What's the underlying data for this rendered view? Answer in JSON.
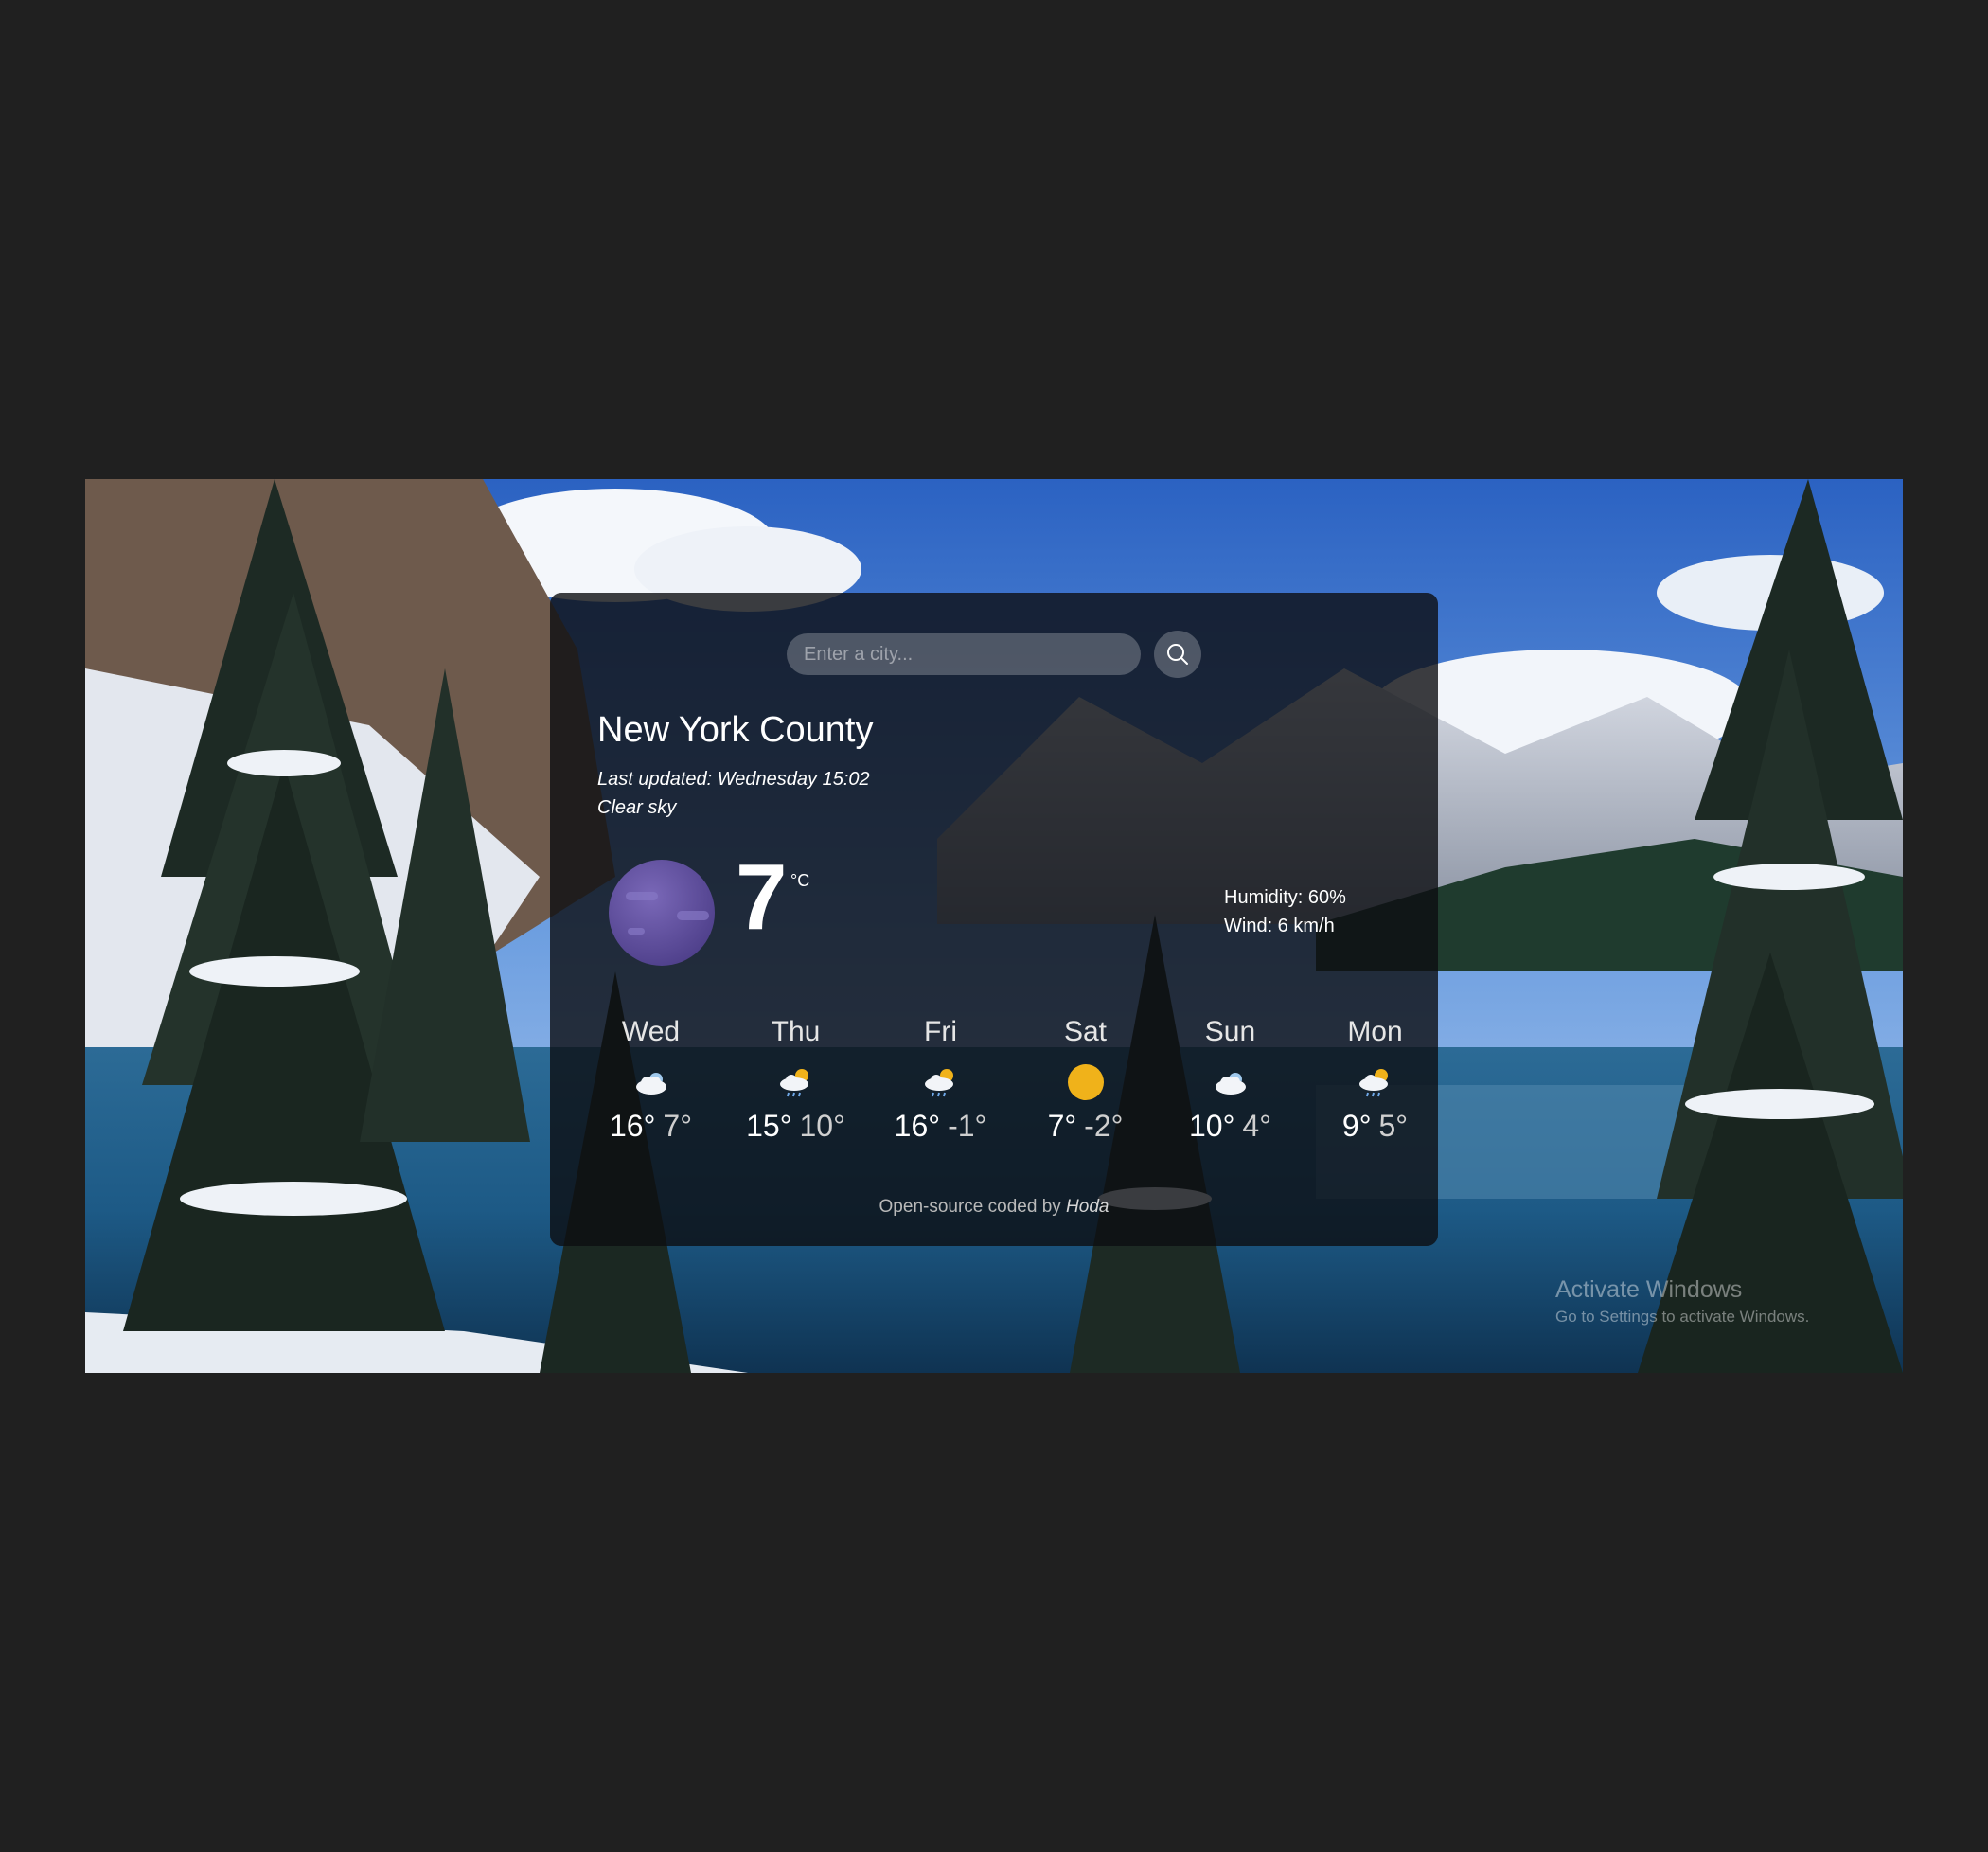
{
  "search": {
    "placeholder": "Enter a city...",
    "button_icon": "search-icon"
  },
  "current": {
    "city": "New York County",
    "last_updated": "Last updated: Wednesday 15:02",
    "description": "Clear sky",
    "temperature": "7",
    "unit": "°C",
    "icon": "night-moon-icon",
    "humidity": "Humidity: 60%",
    "wind": "Wind: 6 km/h"
  },
  "forecast": [
    {
      "day": "Wed",
      "max": "16°",
      "min": "7°",
      "icon": "cloudy-icon"
    },
    {
      "day": "Thu",
      "max": "15°",
      "min": "10°",
      "icon": "rain-sun-icon"
    },
    {
      "day": "Fri",
      "max": "16°",
      "min": "-1°",
      "icon": "rain-sun-icon"
    },
    {
      "day": "Sat",
      "max": "7°",
      "min": "-2°",
      "icon": "sun-icon"
    },
    {
      "day": "Sun",
      "max": "10°",
      "min": "4°",
      "icon": "cloudy-icon"
    },
    {
      "day": "Mon",
      "max": "9°",
      "min": "5°",
      "icon": "rain-sun-icon"
    }
  ],
  "footer": {
    "prefix": "Open-source coded by",
    "author": "Hoda"
  },
  "watermark": {
    "title": "Activate Windows",
    "subtitle": "Go to Settings to activate Windows."
  },
  "colors": {
    "page_background": "#202020",
    "card_background": "#0c0e12",
    "moon": "#5a4a9a",
    "sun": "#f0b21a"
  }
}
